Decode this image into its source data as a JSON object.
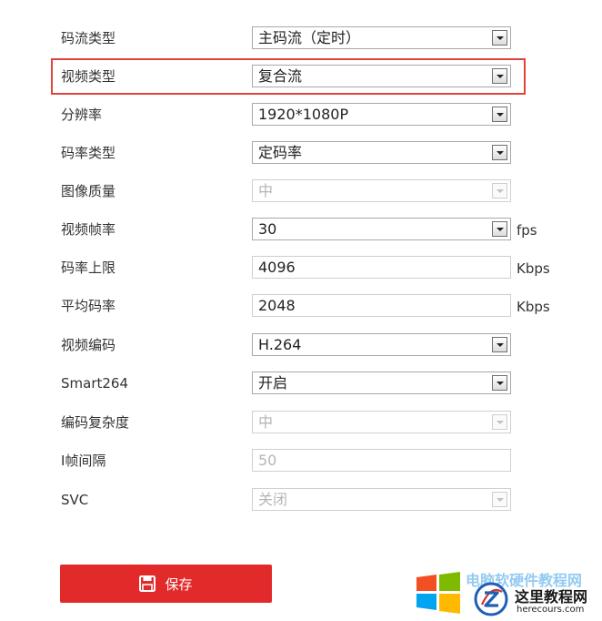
{
  "form": {
    "rows": [
      {
        "label": "码流类型",
        "value": "主码流（定时）",
        "type": "select",
        "disabled": false
      },
      {
        "label": "视频类型",
        "value": "复合流",
        "type": "select",
        "disabled": false
      },
      {
        "label": "分辨率",
        "value": "1920*1080P",
        "type": "select",
        "disabled": false
      },
      {
        "label": "码率类型",
        "value": "定码率",
        "type": "select",
        "disabled": false
      },
      {
        "label": "图像质量",
        "value": "中",
        "type": "select",
        "disabled": true
      },
      {
        "label": "视频帧率",
        "value": "30",
        "type": "select",
        "disabled": false,
        "unit": "fps"
      },
      {
        "label": "码率上限",
        "value": "4096",
        "type": "input",
        "disabled": false,
        "unit": "Kbps"
      },
      {
        "label": "平均码率",
        "value": "2048",
        "type": "input",
        "disabled": false,
        "unit": "Kbps"
      },
      {
        "label": "视频编码",
        "value": "H.264",
        "type": "select",
        "disabled": false
      },
      {
        "label": "Smart264",
        "value": "开启",
        "type": "select",
        "disabled": false
      },
      {
        "label": "编码复杂度",
        "value": "中",
        "type": "select",
        "disabled": true
      },
      {
        "label": "I帧间隔",
        "value": "50",
        "type": "input",
        "disabled": true
      },
      {
        "label": "SVC",
        "value": "关闭",
        "type": "select",
        "disabled": true
      }
    ]
  },
  "save_button": {
    "label": "保存"
  },
  "highlight": {
    "color": "#e2443b"
  },
  "colors": {
    "save": "#e22a2a"
  },
  "watermark": {
    "faded_text": "电脑软硬件教程网",
    "title": "这里教程网",
    "url": "herecours.com"
  }
}
